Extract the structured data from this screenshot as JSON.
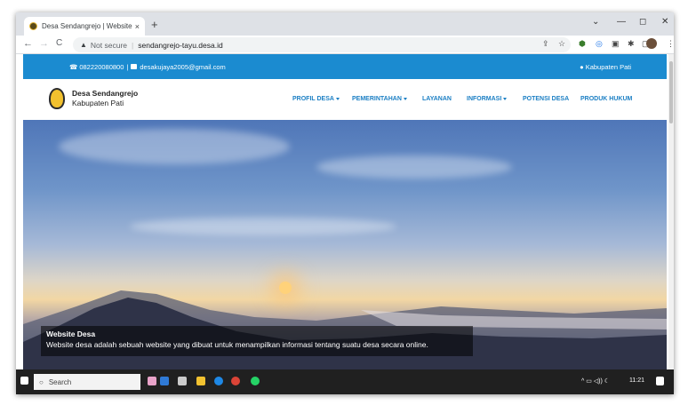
{
  "browser": {
    "tab_title": "Desa Sendangrejo | Website Desa",
    "tab_close": "×",
    "new_tab": "+",
    "win_min": "⌄",
    "win_dash": "—",
    "win_restore": "◻",
    "win_close": "✕",
    "back": "←",
    "forward": "→",
    "reload": "C",
    "security_icon": "▲",
    "security_text": "Not secure",
    "url": "sendangrejo-tayu.desa.id",
    "share": "⇪",
    "star": "☆",
    "ext1": "⬢",
    "ext2": "◎",
    "ext3": "▣",
    "ext4": "✱",
    "ext5": "▢",
    "menu": "⋮"
  },
  "topbar": {
    "phone": "082220080800",
    "divider": "|",
    "email": "desakujaya2005@gmail.com",
    "region": "Kabupaten Pati"
  },
  "header": {
    "title": "Desa Sendangrejo",
    "subtitle": "Kabupaten Pati",
    "nav": [
      {
        "label": "PROFIL DESA",
        "caret": true
      },
      {
        "label": "PEMERINTAHAN",
        "caret": true
      },
      {
        "label": "LAYANAN",
        "caret": false
      },
      {
        "label": "INFORMASI",
        "caret": true
      },
      {
        "label": "POTENSI DESA",
        "caret": false
      },
      {
        "label": "PRODUK HUKUM",
        "caret": false
      }
    ]
  },
  "hero": {
    "caption_title": "Website Desa",
    "caption_text": "Website desa adalah sebuah website yang dibuat untuk menampilkan informasi tentang suatu desa secara online."
  },
  "taskbar": {
    "search_placeholder": "Search",
    "time": "11:21",
    "tray_icons": "^ ▭ ◁)) ☾"
  }
}
